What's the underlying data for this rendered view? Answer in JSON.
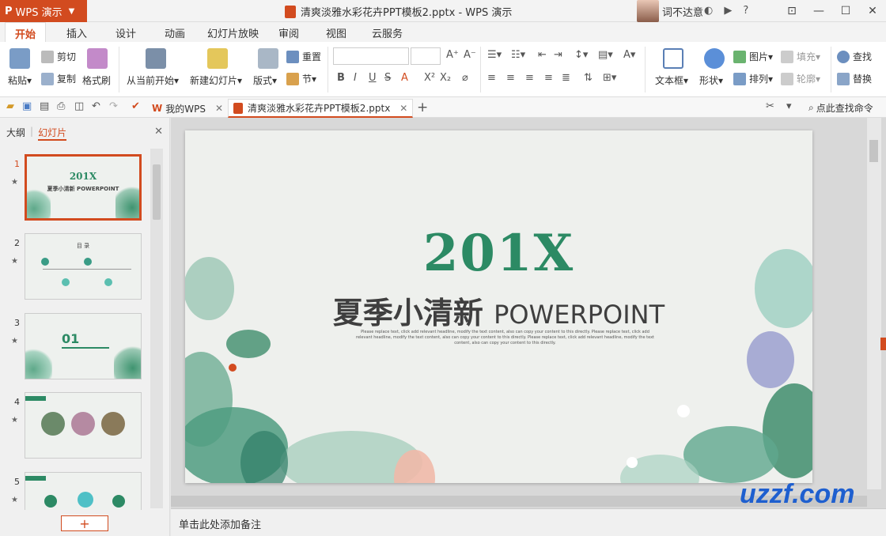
{
  "app": {
    "name": "WPS 演示",
    "doc_title": "清爽淡雅水彩花卉PPT模板2.pptx - WPS 演示",
    "user": "词不达意"
  },
  "menu": [
    "开始",
    "插入",
    "设计",
    "动画",
    "幻灯片放映",
    "审阅",
    "视图",
    "云服务"
  ],
  "ribbon": {
    "paste": "粘贴",
    "cut": "剪切",
    "copy": "复制",
    "format_brush": "格式刷",
    "from_current": "从当前开始",
    "new_slide": "新建幻灯片",
    "layout": "版式",
    "reset": "重置",
    "section": "节",
    "bold": "B",
    "italic": "I",
    "underline": "U",
    "strike": "S",
    "fontcolor": "A",
    "textbox": "文本框",
    "shape": "形状",
    "picture": "图片",
    "fill": "填充",
    "arrange": "排列",
    "outline": "轮廓",
    "find": "查找",
    "replace": "替换"
  },
  "doc_tabs": {
    "mywps": "我的WPS",
    "current": "清爽淡雅水彩花卉PPT模板2.pptx",
    "search": "点此查找命令"
  },
  "left_panel": {
    "tab_outline": "大纲",
    "tab_slides": "幻灯片",
    "slides": [
      {
        "num": "1",
        "title": "201X",
        "subtitle": "夏季小清新 POWERPOINT"
      },
      {
        "num": "2",
        "title": "目 录"
      },
      {
        "num": "3",
        "title": "01"
      },
      {
        "num": "4"
      },
      {
        "num": "5"
      }
    ],
    "add": "+"
  },
  "slide": {
    "year": "201X",
    "title_cn": "夏季小清新",
    "title_en": "POWERPOINT",
    "body": "Please replace text, click add relevant headline, modify the text content, also can copy your content to this directly. Please replace text, click add relevant headline, modify the text content, also can copy your content to this directly. Please replace text, click add relevant headline, modify the text content, also can copy your content to this directly."
  },
  "notes": "单击此处添加备注",
  "watermark": "uzzf.com",
  "colors": {
    "accent": "#d24b1f",
    "slide_green": "#2c8a64"
  }
}
